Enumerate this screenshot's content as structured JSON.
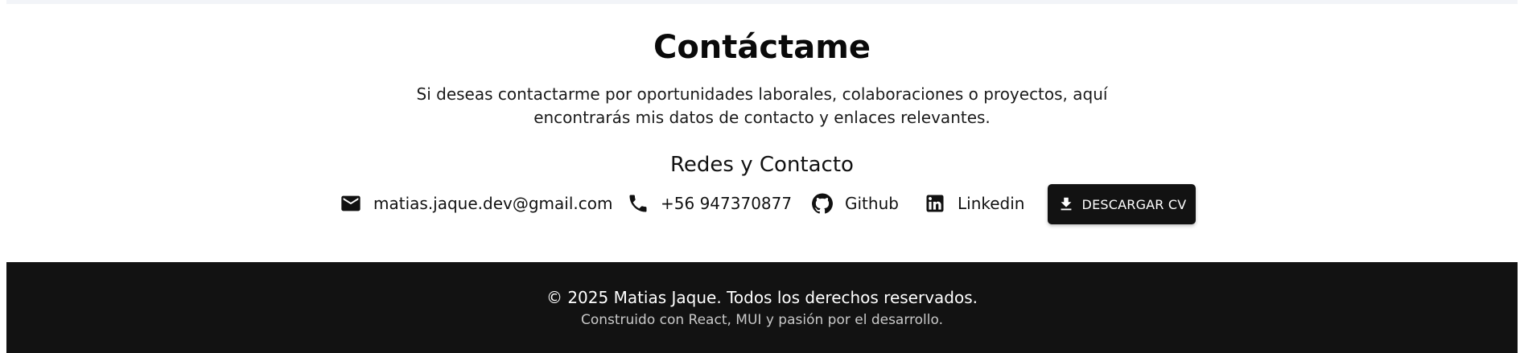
{
  "contact": {
    "title": "Contáctame",
    "description": "Si deseas contactarme por oportunidades laborales, colaboraciones o proyectos, aquí encontrarás mis datos de contacto y enlaces relevantes.",
    "subtitle": "Redes y Contacto",
    "links": {
      "email": {
        "icon": "mail-icon",
        "label": "matias.jaque.dev@gmail.com"
      },
      "phone": {
        "icon": "phone-icon",
        "label": "+56 947370877"
      },
      "github": {
        "icon": "github-icon",
        "label": "Github"
      },
      "linkedin": {
        "icon": "linkedin-icon",
        "label": "Linkedin"
      }
    },
    "cv_button": {
      "icon": "download-icon",
      "label": "DESCARGAR CV"
    }
  },
  "footer": {
    "copyright": "© 2025 Matias Jaque. Todos los derechos reservados.",
    "built_with": "Construido con React, MUI y pasión por el desarrollo."
  },
  "colors": {
    "background": "#ffffff",
    "top_strip": "#f2f4f8",
    "text": "#111111",
    "button_bg": "#121212",
    "footer_bg": "#121212",
    "footer_text": "#ffffff",
    "footer_subtext": "#c9c9c9"
  }
}
